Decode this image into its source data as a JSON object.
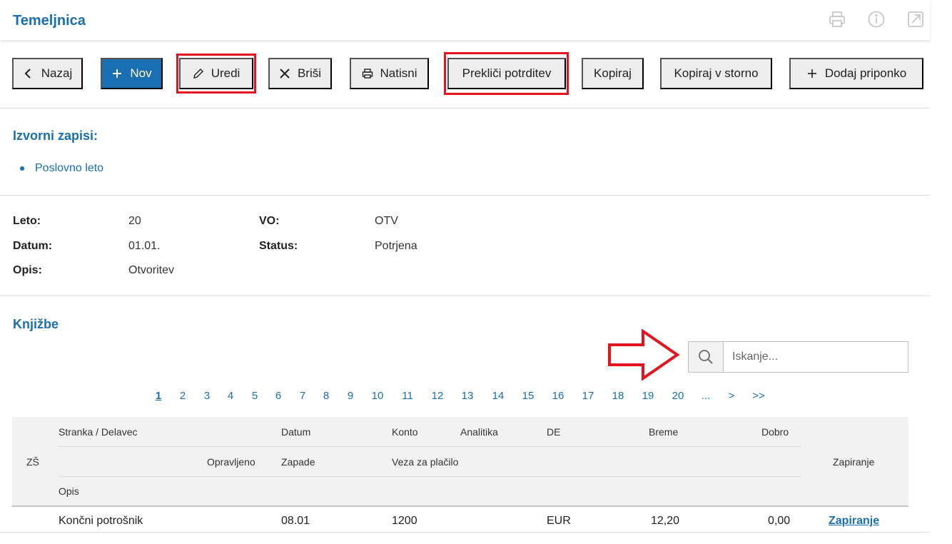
{
  "header": {
    "title": "Temeljnica",
    "icons": [
      "printer-icon",
      "info-icon",
      "open-external-icon"
    ]
  },
  "toolbar": {
    "back": "Nazaj",
    "new": "Nov",
    "edit": "Uredi",
    "delete": "Briši",
    "print": "Natisni",
    "cancel_confirm": "Prekliči potrditev",
    "copy": "Kopiraj",
    "copy_storno": "Kopiraj v storno",
    "add_attachment": "Dodaj priponko"
  },
  "source": {
    "title": "Izvorni zapisi:",
    "items": [
      "Poslovno leto"
    ]
  },
  "info": {
    "year_label": "Leto:",
    "year_value": "20",
    "vo_label": "VO:",
    "vo_value": "OTV",
    "date_label": "Datum:",
    "date_value": "01.01.",
    "status_label": "Status:",
    "status_value": "Potrjena",
    "desc_label": "Opis:",
    "desc_value": "Otvoritev"
  },
  "entries": {
    "title": "Knjižbe",
    "search_placeholder": "Iskanje...",
    "pages": [
      "1",
      "2",
      "3",
      "4",
      "5",
      "6",
      "7",
      "8",
      "9",
      "10",
      "11",
      "12",
      "13",
      "14",
      "15",
      "16",
      "17",
      "18",
      "19",
      "20",
      "...",
      ">",
      ">>"
    ],
    "active_page": "1",
    "columns": {
      "zs": "ZŠ",
      "party": "Stranka / Delavec",
      "date": "Datum",
      "account": "Konto",
      "analytics": "Analitika",
      "de": "DE",
      "debit": "Breme",
      "credit": "Dobro",
      "done": "Opravljeno",
      "due": "Zapade",
      "payment_ref": "Veza za plačilo",
      "closing": "Zapiranje",
      "desc": "Opis"
    },
    "rows": [
      {
        "party": "Končni potrošnik",
        "date": "08.01",
        "account": "1200",
        "currency": "EUR",
        "debit": "12,20",
        "credit": "0,00",
        "closing": "Zapiranje"
      }
    ]
  },
  "colors": {
    "accent": "#1a6fb3",
    "highlight": "#e3141d"
  }
}
